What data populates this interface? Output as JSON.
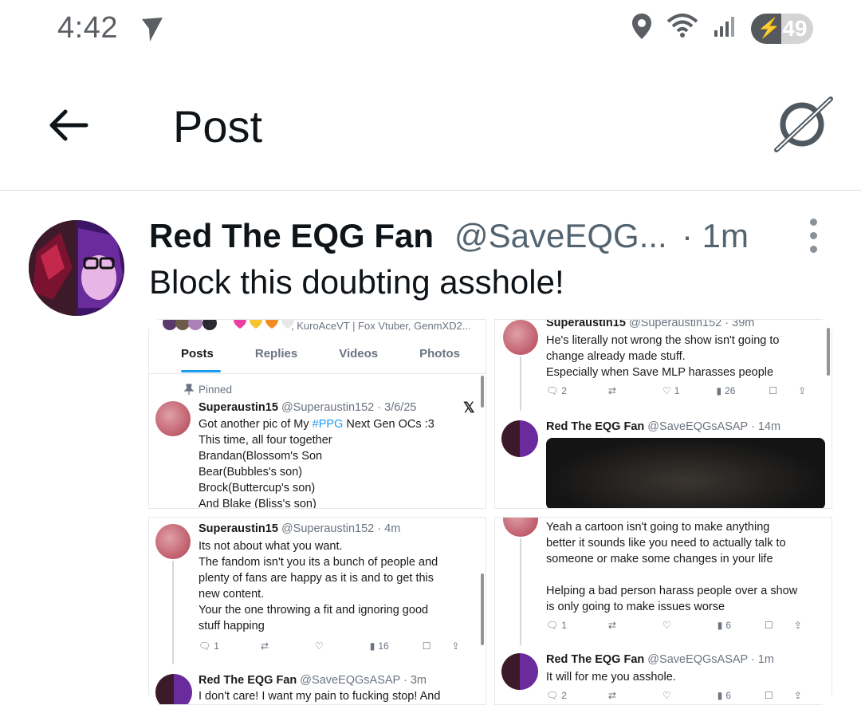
{
  "status_bar": {
    "time": "4:42",
    "battery": "49",
    "battery_level": 0.49
  },
  "header": {
    "title": "Post"
  },
  "post": {
    "author_name": "Red The EQG Fan",
    "author_handle": "@SaveEQG...",
    "time": "· 1m",
    "text": "Block this doubting asshole!"
  },
  "media": {
    "top_left": {
      "header_text": ", KuroAceVT | Fox Vtuber, GenmXD2...",
      "tabs": [
        "Posts",
        "Replies",
        "Videos",
        "Photos"
      ],
      "pinned_label": "Pinned",
      "name": "Superaustin15",
      "handle_date": "@Superaustin152 · 3/6/25",
      "line1_prefix": "Got another pic of My ",
      "line1_hashtag": "#PPG",
      "line1_suffix": " Next Gen OCs :3",
      "lines": [
        "This time, all four together",
        "Brandan(Blossom's Son",
        "Bear(Bubbles's son)",
        "Brock(Buttercup's son)",
        "And Blake (Bliss's son)"
      ]
    },
    "top_right": {
      "name": "Superaustin15",
      "handle_time": "@Superaustin152 · 39m",
      "lines": [
        "He's literally not wrong the show isn't going to",
        "change already made stuff.",
        "Especially when Save MLP harasses people"
      ],
      "replies": "2",
      "likes": "1",
      "views": "26",
      "name2": "Red The EQG Fan",
      "handle2": "@SaveEQGsASAP · 14m"
    },
    "bottom_left": {
      "name": "Superaustin15",
      "handle_time": "@Superaustin152 · 4m",
      "lines": [
        "Its not about what you want.",
        "The fandom isn't you its a bunch of people and",
        "plenty of fans are happy as it is and to get this",
        "new content.",
        "Your the one throwing a fit and ignoring good",
        "stuff happing"
      ],
      "replies": "1",
      "views": "16",
      "name2": "Red The EQG Fan",
      "handle2": "@SaveEQGsASAP · 3m",
      "line2": "I don't care! I want my pain to fucking stop! And"
    },
    "bottom_right": {
      "lines": [
        "Yeah a cartoon isn't going to make anything",
        "better it sounds like you need to actually talk to",
        "someone or make some changes in your life",
        "",
        "Helping a bad person harass people over a show",
        "is only going to make issues worse"
      ],
      "replies": "1",
      "views": "6",
      "name2": "Red The EQG Fan",
      "handle2": "@SaveEQGsASAP · 1m",
      "line2": "It will for me you asshole.",
      "replies2": "2",
      "views2": "6"
    }
  },
  "colors": {
    "text": "#0f1419",
    "secondary": "#536471",
    "accent": "#1d9bf0",
    "divider": "#d7dce0"
  }
}
